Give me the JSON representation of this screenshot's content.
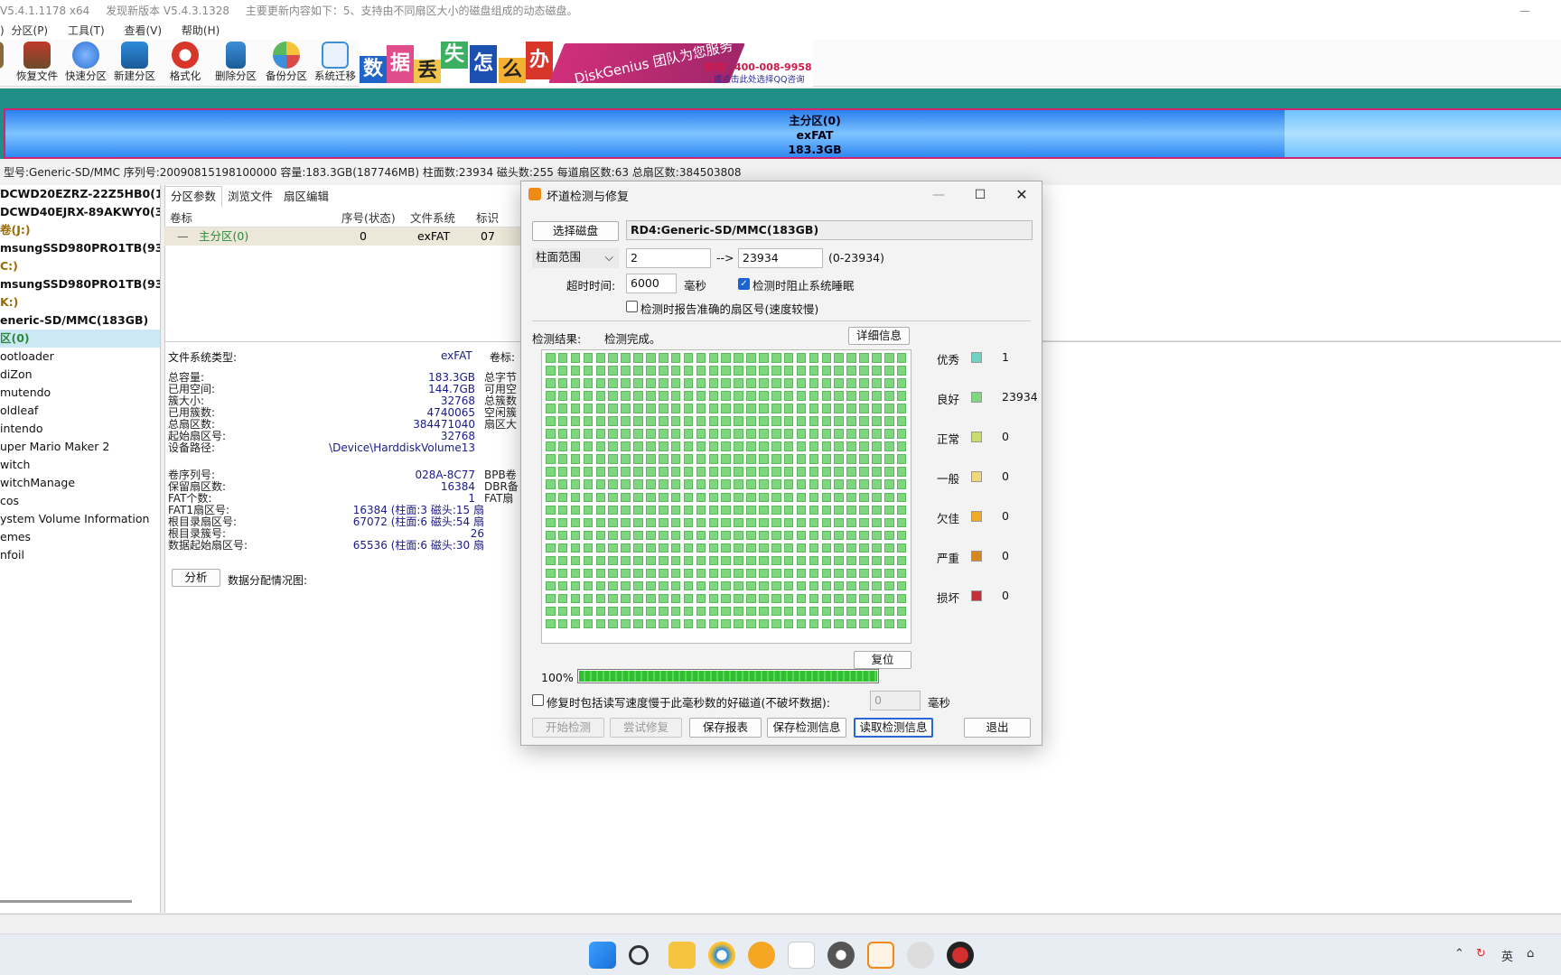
{
  "titlebar": {
    "version": "V5.4.1.1178 x64",
    "update": "发现新版本 V5.4.3.1328",
    "notes": "主要更新内容如下：5、支持由不同扇区大小的磁盘组成的动态磁盘。"
  },
  "menu": [
    "分区(P)",
    "工具(T)",
    "查看(V)",
    "帮助(H)"
  ],
  "toolbar": [
    "恢复文件",
    "快速分区",
    "新建分区",
    "格式化",
    "删除分区",
    "备份分区",
    "系统迁移"
  ],
  "banner": {
    "chars": [
      "数",
      "据",
      "丢",
      "失",
      "怎",
      "么",
      "办"
    ],
    "ribbon": "DiskGenius 团队为您服务",
    "phone": "致电：400-008-9958",
    "qq": "或点击此处选择QQ咨询"
  },
  "partition_bar": {
    "name": "主分区(0)",
    "fs": "exFAT",
    "size": "183.3GB"
  },
  "disk_info": "型号:Generic-SD/MMC  序列号:20090815198100000  容量:183.3GB(187746MB)  柱面数:23934  磁头数:255  每道扇区数:63  总扇区数:384503808",
  "tree": [
    {
      "t": "DCWD20EZRZ-22Z5HB0(1863",
      "s": "b"
    },
    {
      "t": "DCWD40EJRX-89AKWY0(3726",
      "s": "b"
    },
    {
      "t": "卷(J:)",
      "s": "o"
    },
    {
      "t": "msungSSD980PRO1TB(932GB",
      "s": "b"
    },
    {
      "t": "C:)",
      "s": "o"
    },
    {
      "t": "msungSSD980PRO1TB(932GB",
      "s": "b"
    },
    {
      "t": "K:)",
      "s": "o"
    },
    {
      "t": "eneric-SD/MMC(183GB)",
      "s": "b"
    },
    {
      "t": "区(0)",
      "s": "g"
    },
    {
      "t": "ootloader",
      "s": ""
    },
    {
      "t": "diZon",
      "s": ""
    },
    {
      "t": "mutendo",
      "s": ""
    },
    {
      "t": "oldleaf",
      "s": ""
    },
    {
      "t": "intendo",
      "s": ""
    },
    {
      "t": "uper Mario Maker 2",
      "s": ""
    },
    {
      "t": "witch",
      "s": ""
    },
    {
      "t": "witchManage",
      "s": ""
    },
    {
      "t": "cos",
      "s": ""
    },
    {
      "t": "ystem Volume Information",
      "s": ""
    },
    {
      "t": "emes",
      "s": ""
    },
    {
      "t": "nfoil",
      "s": ""
    }
  ],
  "tabs": [
    "分区参数",
    "浏览文件",
    "扇区编辑"
  ],
  "ptable": {
    "headers": [
      "卷标",
      "序号(状态)",
      "文件系统",
      "标识"
    ],
    "row": [
      "主分区(0)",
      "0",
      "exFAT",
      "07"
    ]
  },
  "fs": {
    "type_label": "文件系统类型:",
    "type_value": "exFAT",
    "vol_label": "卷标:"
  },
  "fs_block1": [
    [
      "总容量:",
      "183.3GB",
      "总字节"
    ],
    [
      "已用空间:",
      "144.7GB",
      "可用空"
    ],
    [
      "簇大小:",
      "32768",
      "总簇数"
    ],
    [
      "已用簇数:",
      "4740065",
      "空闲簇"
    ],
    [
      "总扇区数:",
      "384471040",
      "扇区大"
    ],
    [
      "起始扇区号:",
      "32768",
      ""
    ],
    [
      "设备路径:",
      "\\Device\\HarddiskVolume13",
      ""
    ]
  ],
  "fs_block2": [
    [
      "卷序列号:",
      "028A-8C77",
      "BPB卷"
    ],
    [
      "保留扇区数:",
      "16384",
      "DBR备"
    ],
    [
      "FAT个数:",
      "1",
      "FAT扇"
    ],
    [
      "FAT1扇区号:",
      "16384 (柱面:3 磁头:15 扇",
      ""
    ],
    [
      "根目录扇区号:",
      "67072 (柱面:6 磁头:54 扇",
      ""
    ],
    [
      "根目录簇号:",
      "26",
      ""
    ],
    [
      "数据起始扇区号:",
      "65536 (柱面:6 磁头:30 扇",
      ""
    ]
  ],
  "analyze": {
    "button": "分析",
    "label": "数据分配情况图:"
  },
  "dialog": {
    "title": "坏道检测与修复",
    "select_disk": "选择磁盘",
    "disk": "RD4:Generic-SD/MMC(183GB)",
    "range_type": "柱面范围",
    "range_from": "2",
    "arrow": "-->",
    "range_to": "23934",
    "range_hint": "(0-23934)",
    "timeout_label": "超时时间:",
    "timeout_value": "6000",
    "timeout_unit": "毫秒",
    "prevent_sleep": "检测时阻止系统睡眠",
    "report_sector": "检测时报告准确的扇区号(速度较慢)",
    "result_label": "检测结果:",
    "result_value": "检测完成。",
    "details": "详细信息",
    "reset": "复位",
    "progress_text": "100%",
    "progress": 1.0,
    "repair_opt": "修复时包括读写速度慢于此毫秒数的好磁道(不破坏数据):",
    "repair_ms": "0",
    "repair_unit": "毫秒",
    "buttons": [
      "开始检测",
      "尝试修复",
      "保存报表",
      "保存检测信息",
      "读取检测信息",
      "退出"
    ],
    "legend": [
      {
        "label": "优秀",
        "color": "#6fd3c3",
        "count": "1"
      },
      {
        "label": "良好",
        "color": "#7ed67e",
        "count": "23934"
      },
      {
        "label": "正常",
        "color": "#c9de6a",
        "count": "0"
      },
      {
        "label": "一般",
        "color": "#f2d77a",
        "count": "0"
      },
      {
        "label": "欠佳",
        "color": "#f2a928",
        "count": "0"
      },
      {
        "label": "严重",
        "color": "#d9861a",
        "count": "0"
      },
      {
        "label": "损坏",
        "color": "#c2303a",
        "count": "0"
      }
    ]
  },
  "tray": {
    "ime": "英"
  }
}
